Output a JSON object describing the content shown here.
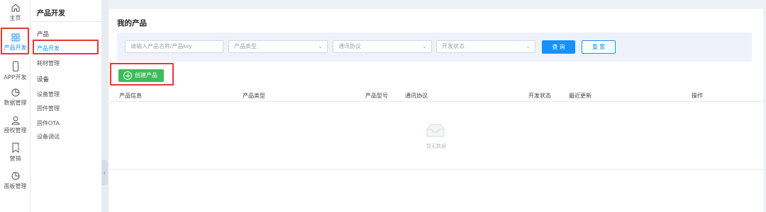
{
  "rail": {
    "items": [
      {
        "label": "主页",
        "icon": "home-icon"
      },
      {
        "label": "产品开发",
        "icon": "grid-icon",
        "active": true
      },
      {
        "label": "APP开发",
        "icon": "phone-icon"
      },
      {
        "label": "数据管理",
        "icon": "pie-chart-icon"
      },
      {
        "label": "授权管理",
        "icon": "user-icon"
      },
      {
        "label": "营销",
        "icon": "bookmark-icon"
      },
      {
        "label": "面板管理",
        "icon": "pie-chart-icon"
      }
    ]
  },
  "submenu": {
    "title": "产品开发",
    "items": [
      {
        "label": "产品",
        "type": "group"
      },
      {
        "label": "产品开发",
        "active": true
      },
      {
        "label": "耗材管理"
      },
      {
        "label": "设备",
        "type": "group"
      },
      {
        "label": "设备管理"
      },
      {
        "label": "固件管理"
      },
      {
        "label": "固件OTA"
      },
      {
        "label": "设备调试"
      }
    ],
    "collapse_glyph": "‹"
  },
  "main": {
    "title": "我的产品",
    "filters": {
      "search_placeholder": "请输入产品名称/产品key",
      "product_type": "产品类型",
      "protocol": "通讯协议",
      "dev_status": "开发状态",
      "query_label": "查 询",
      "reset_label": "重 置"
    },
    "create_label": "创建产品",
    "table": {
      "headers": [
        "产品信息",
        "产品类型",
        "产品型号",
        "通讯协议",
        "开发状态",
        "最近更新",
        "操作"
      ],
      "empty_text": "暂无数据"
    }
  },
  "colors": {
    "primary": "#1890ff",
    "create_green": "#3dbd5a",
    "highlight_red": "#e53935"
  }
}
